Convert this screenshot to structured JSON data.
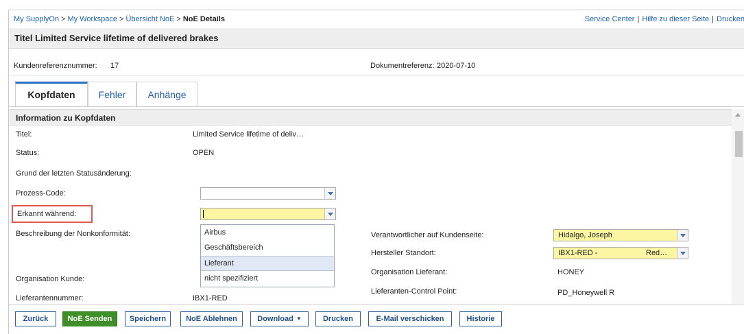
{
  "breadcrumb": {
    "items": [
      "My SupplyOn",
      "My Workspace",
      "Übersicht NoE"
    ],
    "separator": ">",
    "current": "NoE Details"
  },
  "top_links": [
    "Service Center",
    "Hilfe zu dieser Seite",
    "Drucken"
  ],
  "top_links_separator": "|",
  "page_title": "Titel Limited Service lifetime of delivered brakes",
  "refs": {
    "customer_ref_label": "Kundenreferenznummer:",
    "customer_ref_value": "17",
    "doc_ref_label": "Dokumentreferenz:",
    "doc_ref_value": "2020-07-10"
  },
  "tabs": [
    {
      "label": "Kopfdaten",
      "active": true
    },
    {
      "label": "Fehler",
      "active": false
    },
    {
      "label": "Anhänge",
      "active": false
    }
  ],
  "section_title": "Information zu Kopfdaten",
  "fields": {
    "titel_label": "Titel:",
    "titel_value": "Limited Service lifetime of deliv…",
    "status_label": "Status:",
    "status_value": "OPEN",
    "grund_label": "Grund der letzten Statusänderung:",
    "prozess_label": "Prozess-Code:",
    "prozess_value": "",
    "erkannt_label": "Erkannt während:",
    "erkannt_value": "",
    "beschreibung_label": "Beschreibung der Nonkonformität:",
    "org_kunde_label": "Organisation Kunde:",
    "lieferantennummer_label": "Lieferantennummer:",
    "lieferantennummer_value": "IBX1-RED"
  },
  "dropdown": {
    "options": [
      "Airbus",
      "Geschäftsbereich",
      "Lieferant",
      "nicht spezifiziert"
    ],
    "highlighted": "Lieferant"
  },
  "right_fields": {
    "verantwortlicher_label": "Verantwortlicher auf Kundenseite:",
    "verantwortlicher_value": "Hidalgo, Joseph",
    "hersteller_label": "Hersteller Standort:",
    "hersteller_value_a": "IBX1-RED -",
    "hersteller_value_b": "Red…",
    "org_lieferant_label": "Organisation Lieferant:",
    "org_lieferant_value": "HONEY",
    "control_point_label": "Lieferanten-Control Point:",
    "control_point_value": "PD_Honeywell R"
  },
  "buttons": {
    "zurueck": "Zurück",
    "senden": "NoE Senden",
    "speichern": "Speichern",
    "ablehnen": "NoE Ablehnen",
    "download": "Download",
    "drucken": "Drucken",
    "email": "E-Mail verschicken",
    "historie": "Historie"
  },
  "colors": {
    "link_blue": "#1f63b4",
    "field_yellow": "#fcf6a2",
    "primary_green": "#3e8f2a",
    "highlight_red": "#e0584f"
  }
}
